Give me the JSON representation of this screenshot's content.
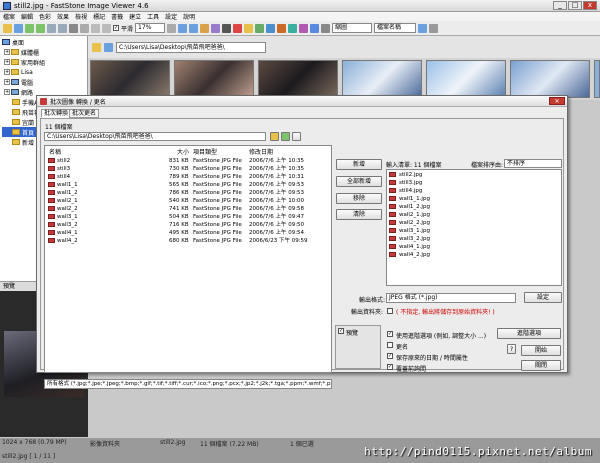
{
  "app": {
    "title": "still2.jpg - FastStone Image Viewer 4.6"
  },
  "menu": [
    "檔案",
    "編輯",
    "色彩",
    "效果",
    "檢視",
    "標記",
    "書籤",
    "建立",
    "工具",
    "設定",
    "說明"
  ],
  "toolbar": {
    "zoom": "17%",
    "smooth_label": "平滑",
    "view_mode": "縮圖",
    "sort_mode": "檔案名稱"
  },
  "tree": {
    "root": "桌面",
    "items": [
      "媒體櫃",
      "家用群組",
      "Lisa",
      "電腦",
      "網路",
      "手機APP",
      "飛苗看",
      "宜蘭",
      "首頁",
      "新增"
    ]
  },
  "path": "C:\\Users\\Lisa\\Desktop\\飛苗飛吧爸爸\\",
  "preview": {
    "label": "預覽"
  },
  "status": {
    "left": "1024 x 768 (0.79 MP)",
    "mid1": "影像資料夾",
    "mid2": "still2.jpg",
    "mid3": "11 個檔案 (7.22 MB)",
    "mid4": "1 個已選",
    "page": "still2.jpg [ 1 / 11 ]"
  },
  "dialog": {
    "title": "批次圖像 轉換 / 更名",
    "tab_convert": "批次轉換",
    "tab_rename": "批次更名",
    "file_count": "11 個檔案",
    "path": "C:\\Users\\Lisa\\Desktop\\飛苗飛吧爸爸\\",
    "cols": {
      "name": "名稱",
      "size": "大小",
      "type": "項目類型",
      "date": "修改日期"
    },
    "files": [
      {
        "name": "still2",
        "size": "831 KB",
        "type": "FastStone JPG File",
        "date": "2006/7/6 上午 10:35"
      },
      {
        "name": "still3",
        "size": "730 KB",
        "type": "FastStone JPG File",
        "date": "2006/7/6 上午 10:35"
      },
      {
        "name": "still4",
        "size": "789 KB",
        "type": "FastStone JPG File",
        "date": "2006/7/6 上午 10:31"
      },
      {
        "name": "wall1_1",
        "size": "565 KB",
        "type": "FastStone JPG File",
        "date": "2006/7/6 上午 09:53"
      },
      {
        "name": "wall1_2",
        "size": "786 KB",
        "type": "FastStone JPG File",
        "date": "2006/7/6 上午 09:53"
      },
      {
        "name": "wall2_1",
        "size": "540 KB",
        "type": "FastStone JPG File",
        "date": "2006/7/6 上午 10:00"
      },
      {
        "name": "wall2_2",
        "size": "741 KB",
        "type": "FastStone JPG File",
        "date": "2006/7/6 上午 09:58"
      },
      {
        "name": "wall3_1",
        "size": "504 KB",
        "type": "FastStone JPG File",
        "date": "2006/7/6 上午 09:47"
      },
      {
        "name": "wall3_2",
        "size": "716 KB",
        "type": "FastStone JPG File",
        "date": "2006/7/6 上午 09:50"
      },
      {
        "name": "wall4_1",
        "size": "495 KB",
        "type": "FastStone JPG File",
        "date": "2006/7/6 上午 09:54"
      },
      {
        "name": "wall4_2",
        "size": "680 KB",
        "type": "FastStone JPG File",
        "date": "2006/6/23 下午 09:59"
      }
    ],
    "buttons": {
      "add": "新增",
      "add_all": "全部新增",
      "remove": "移除",
      "clear": "清除"
    },
    "input_list_label": "輸入清單: 11 個檔案",
    "sort_label": "檔案排序由:",
    "sort_value": "不排序",
    "input_files": [
      "still2.jpg",
      "still3.jpg",
      "still4.jpg",
      "wall1_1.jpg",
      "wall1_2.jpg",
      "wall2_1.jpg",
      "wall2_2.jpg",
      "wall3_1.jpg",
      "wall3_2.jpg",
      "wall4_1.jpg",
      "wall4_2.jpg"
    ],
    "output_format_label": "輸出格式:",
    "output_format_value": "JPEG 格式 (*.jpg)",
    "settings_button": "設定",
    "output_folder_label": "輸出資料夾:",
    "output_folder_note": "( 不指定, 輸出將儲存到原始資料夾! )",
    "preview_label": "預覽",
    "opt_advanced": "使用進階選項 (例如, 調整大小 ...)",
    "advanced_button": "進階選項",
    "opt_rename": "更名",
    "opt_keep_date": "保存原來的日期 / 時間屬性",
    "opt_overwrite": "覆蓋前詢問",
    "start_button": "開始",
    "close_button": "關閉",
    "filter": "所有格式 (*.jpg;*.jpe;*.jpeg;*.bmp;*.gif;*.tif;*.tiff;*.cur;*.ico;*.png;*.pcx;*.jp2;*.j2k;*.tga;*.ppm;*.wmf;*.psd;*.cr"
  },
  "watermark": "http://pind0115.pixnet.net/album",
  "colors": {
    "accent": "#3366cc",
    "warning_text": "#cc0000",
    "jpg_icon": "#c43a3a"
  }
}
